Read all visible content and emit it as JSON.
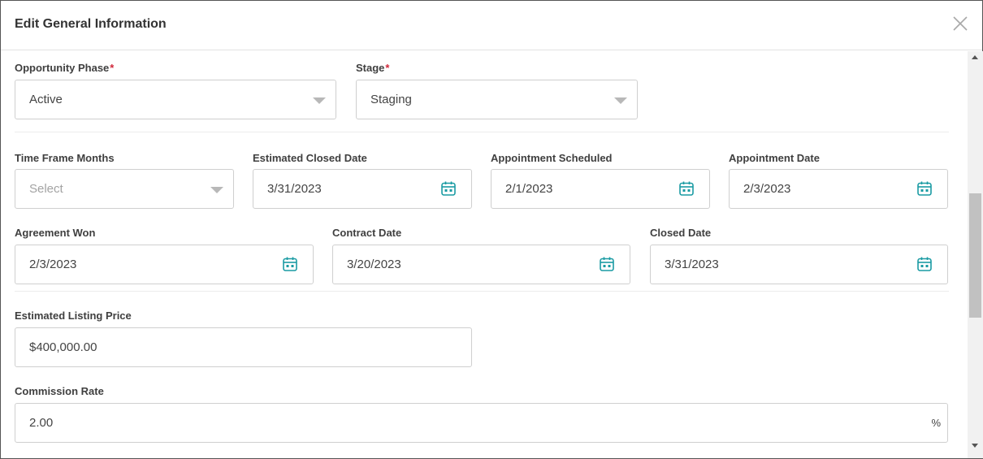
{
  "dialog": {
    "title": "Edit General Information"
  },
  "required_mark": "*",
  "fields": {
    "opportunity_phase": {
      "label": "Opportunity Phase",
      "value": "Active",
      "required": true
    },
    "stage": {
      "label": "Stage",
      "value": "Staging",
      "required": true
    },
    "time_frame_months": {
      "label": "Time Frame Months",
      "placeholder": "Select"
    },
    "estimated_closed_date": {
      "label": "Estimated Closed Date",
      "value": "3/31/2023"
    },
    "appointment_scheduled": {
      "label": "Appointment Scheduled",
      "value": "2/1/2023"
    },
    "appointment_date": {
      "label": "Appointment Date",
      "value": "2/3/2023"
    },
    "agreement_won": {
      "label": "Agreement Won",
      "value": "2/3/2023"
    },
    "contract_date": {
      "label": "Contract Date",
      "value": "3/20/2023"
    },
    "closed_date": {
      "label": "Closed Date",
      "value": "3/31/2023"
    },
    "estimated_listing_price": {
      "label": "Estimated Listing Price",
      "value": "$400,000.00"
    },
    "commission_rate": {
      "label": "Commission Rate",
      "value": "2.00",
      "suffix": "%"
    }
  },
  "icons": {
    "close": "close-icon",
    "dropdown": "chevron-down-icon",
    "date": "calendar-icon"
  },
  "colors": {
    "accent": "#1a9ba3",
    "required": "#d0283a",
    "border": "#cfcfcf"
  }
}
